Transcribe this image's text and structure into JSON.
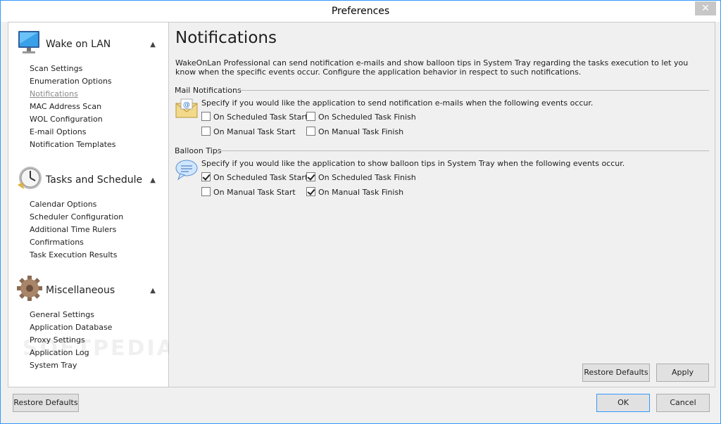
{
  "window": {
    "title": "Preferences",
    "close_glyph": "✕"
  },
  "sidebar": {
    "groups": [
      {
        "title": "Wake on LAN",
        "icon": "monitor-icon",
        "items": [
          "Scan Settings",
          "Enumeration Options",
          "Notifications",
          "MAC Address Scan",
          "WOL Configuration",
          "E-mail Options",
          "Notification Templates"
        ]
      },
      {
        "title": "Tasks and Schedule",
        "icon": "clock-icon",
        "items": [
          "Calendar Options",
          "Scheduler Configuration",
          "Additional Time Rulers",
          "Confirmations",
          "Task Execution Results"
        ]
      },
      {
        "title": "Miscellaneous",
        "icon": "gear-icon",
        "items": [
          "General Settings",
          "Application Database",
          "Proxy Settings",
          "Application Log",
          "System Tray"
        ]
      }
    ],
    "active_item": "Notifications",
    "watermark": "SOFTPEDIA"
  },
  "main": {
    "title": "Notifications",
    "description": "WakeOnLan Professional can send notification e-mails and show balloon tips in System Tray regarding the tasks execution to let you know when the specific events occur. Configure the application behavior in respect to such notifications.",
    "mail": {
      "label": "Mail Notifications",
      "desc": "Specify if you would like the application to send notification e-mails when the following events occur.",
      "options": [
        {
          "label": "On Scheduled Task Start",
          "checked": false
        },
        {
          "label": "On Scheduled Task Finish",
          "checked": false
        },
        {
          "label": "On Manual Task Start",
          "checked": false
        },
        {
          "label": "On Manual Task Finish",
          "checked": false
        }
      ]
    },
    "balloon": {
      "label": "Balloon Tips",
      "desc": "Specify if you would like the application to show balloon tips in System Tray when the following events occur.",
      "options": [
        {
          "label": "On Scheduled Task Start",
          "checked": true
        },
        {
          "label": "On Scheduled Task Finish",
          "checked": true
        },
        {
          "label": "On Manual Task Start",
          "checked": false
        },
        {
          "label": "On Manual Task Finish",
          "checked": true
        }
      ]
    },
    "restore_label": "Restore Defaults",
    "apply_label": "Apply"
  },
  "footer": {
    "restore_label": "Restore Defaults",
    "ok_label": "OK",
    "cancel_label": "Cancel"
  },
  "colors": {
    "accent": "#3399ff",
    "panel_bg": "#ffffff",
    "window_bg": "#f0f0f0"
  }
}
